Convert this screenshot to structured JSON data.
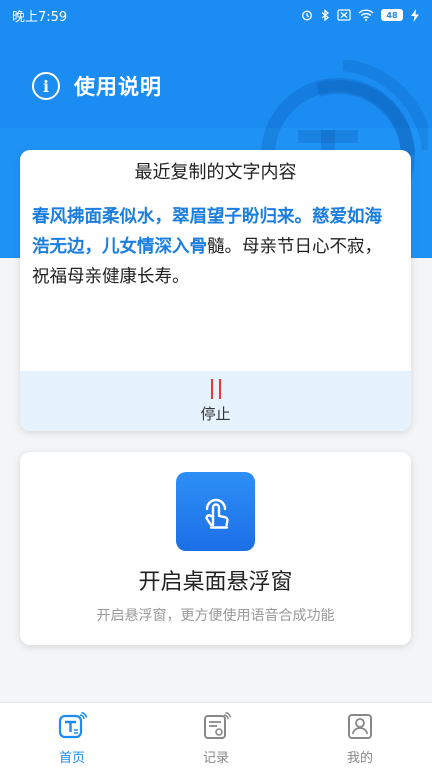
{
  "status_bar": {
    "time": "晚上7:59",
    "battery": "48"
  },
  "header": {
    "title": "使用说明"
  },
  "clipboard_card": {
    "title": "最近复制的文字内容",
    "text_read": "春风拂面柔似水，翠眉望子盼归来。慈爱如海浩无边，儿女情深入骨",
    "text_unread": "髓。母亲节日心不寂，祝福母亲健康长寿。",
    "stop_label": "停止"
  },
  "float_card": {
    "title": "开启桌面悬浮窗",
    "description": "开启悬浮窗，更方便使用语音合成功能"
  },
  "bottom_nav": {
    "items": [
      {
        "label": "首页",
        "icon": "home-text-icon",
        "active": true
      },
      {
        "label": "记录",
        "icon": "record-icon",
        "active": false
      },
      {
        "label": "我的",
        "icon": "profile-icon",
        "active": false
      }
    ]
  },
  "colors": {
    "primary": "#1a8cf2",
    "highlight_text": "#1a7ee0",
    "stop_red": "#e53935",
    "footer_bg": "#e6f3fc"
  }
}
